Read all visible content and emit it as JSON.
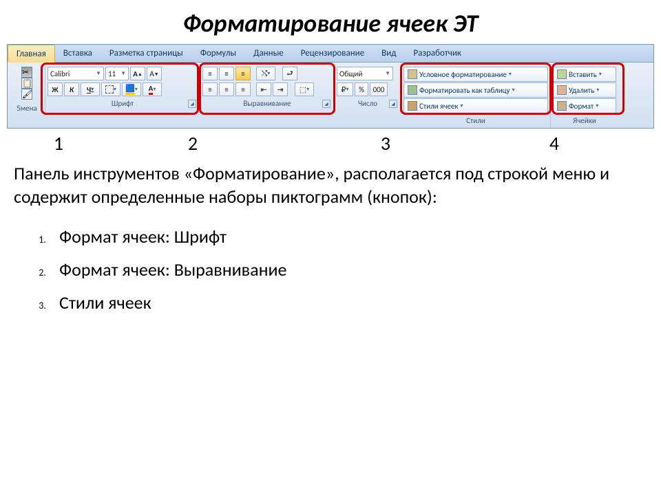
{
  "title": "Форматирование ячеек ЭТ",
  "tabs": [
    "Главная",
    "Вставка",
    "Разметка страницы",
    "Формулы",
    "Данные",
    "Рецензирование",
    "Вид",
    "Разработчик"
  ],
  "active_tab": 0,
  "clipboard_label": "5мена",
  "font": {
    "name": "Calibri",
    "size": "11",
    "label": "Шрифт",
    "bold": "Ж",
    "italic": "К",
    "underline": "Ч"
  },
  "align": {
    "label": "Выравнивание"
  },
  "number": {
    "label": "Число",
    "format": "Общий",
    "percent": "%",
    "thou": "000"
  },
  "styles": {
    "label": "Стили",
    "cond": "Условное форматирование",
    "table": "Форматировать как таблицу",
    "cell": "Стили ячеек"
  },
  "cells": {
    "label": "Ячейки",
    "insert": "Вставить",
    "delete": "Удалить",
    "format": "Формат"
  },
  "nums": [
    "1",
    "2",
    "3",
    "4"
  ],
  "para": "Панель инструментов «Форматирование», располагается под строкой меню и содержит определенные наборы пиктограмм (кнопок):",
  "list": [
    "Формат ячеек: Шрифт",
    "Формат ячеек: Выравнивание",
    "Стили ячеек"
  ]
}
